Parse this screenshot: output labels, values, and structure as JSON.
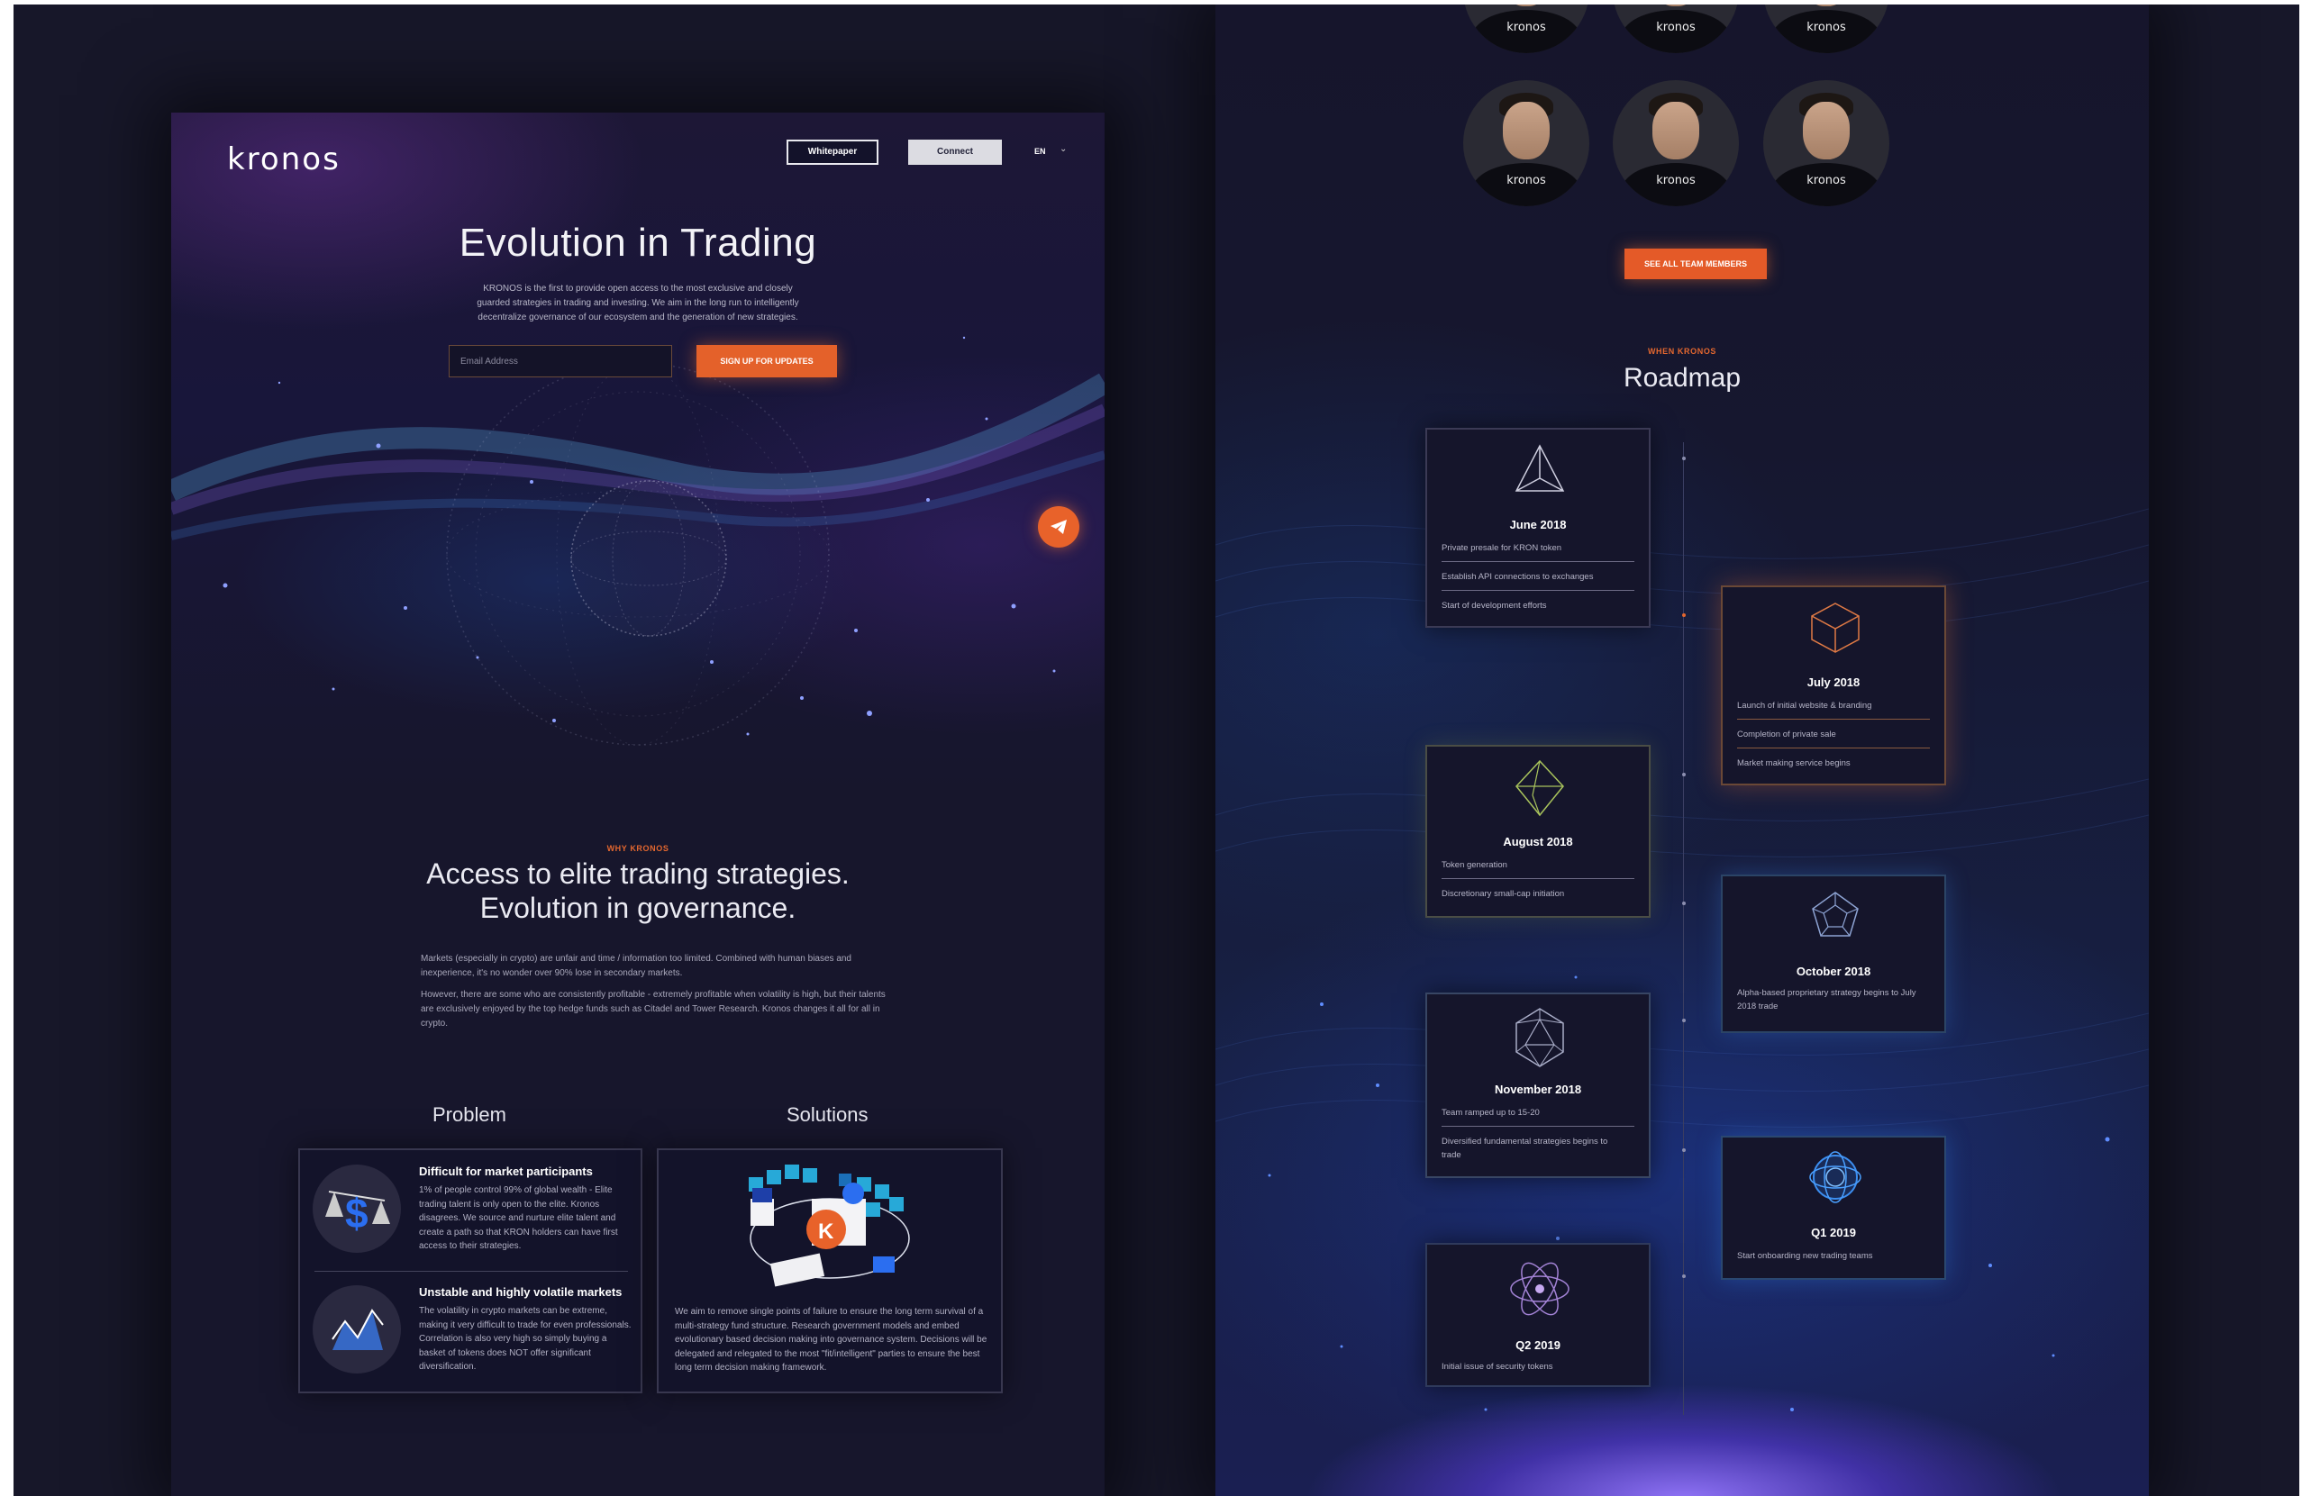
{
  "left_page": {
    "logo": "kronos",
    "nav": {
      "whitepaper_label": "Whitepaper",
      "connect_label": "Connect",
      "language": "EN"
    },
    "hero": {
      "title": "Evolution in Trading",
      "description": "KRONOS is the first to provide open access to the most exclusive and closely guarded strategies in trading and investing. We aim in the long run to intelligently decentralize governance of our ecosystem and the generation of new strategies.",
      "email_placeholder": "Email Address",
      "signup_label": "SIGN UP FOR UPDATES"
    },
    "why": {
      "kicker": "WHY KRONOS",
      "title_line1": "Access to elite trading strategies.",
      "title_line2": "Evolution in governance.",
      "para1": "Markets (especially in crypto) are unfair and time / information too limited. Combined with human biases and inexperience, it's no wonder over 90% lose in secondary markets.",
      "para2": "However, there are some who are consistently profitable - extremely profitable when volatility is high, but their talents are exclusively enjoyed by the top hedge funds such as Citadel and Tower Research. Kronos changes it all for all in crypto."
    },
    "problem": {
      "title": "Problem",
      "items": [
        {
          "heading": "Difficult for market participants",
          "text": "1% of people control 99% of global wealth - Elite trading talent is only open to the elite. Kronos disagrees. We source and nurture elite talent and create a path so that KRON holders can have first access to their strategies."
        },
        {
          "heading": "Unstable and highly volatile markets",
          "text": "The volatility in crypto markets can be extreme, making it very difficult to trade for even professionals. Correlation is also very high so simply buying a basket of tokens does NOT offer significant diversification."
        }
      ]
    },
    "solutions": {
      "title": "Solutions",
      "text": "We aim to remove single points of failure to ensure the long term survival of a multi-strategy fund structure. Research government models and embed evolutionary based decision making into governance system. Decisions will be delegated and relegated to the most \"fit/intelligent\" parties to ensure the best long term decision making framework."
    }
  },
  "right_page": {
    "team_brand": "kronos",
    "see_all_label": "SEE ALL TEAM MEMBERS",
    "roadmap_kicker": "WHEN KRONOS",
    "roadmap_title": "Roadmap",
    "milestones": [
      {
        "date": "June 2018",
        "items": [
          "Private presale for KRON token",
          "Establish API connections to exchanges",
          "Start of development efforts"
        ]
      },
      {
        "date": "July 2018",
        "items": [
          "Launch of initial website & branding",
          "Completion of private sale",
          "Market making service begins"
        ]
      },
      {
        "date": "August 2018",
        "items": [
          "Token generation",
          "Discretionary small-cap initiation"
        ]
      },
      {
        "date": "October 2018",
        "items": [
          "Alpha-based proprietary strategy begins to July 2018 trade"
        ]
      },
      {
        "date": "November 2018",
        "items": [
          "Team ramped up to 15-20",
          "Diversified fundamental strategies begins to trade"
        ]
      },
      {
        "date": "Q1 2019",
        "items": [
          "Start onboarding new trading teams"
        ]
      },
      {
        "date": "Q2 2019",
        "items": [
          "Initial issue of security tokens"
        ]
      }
    ]
  },
  "colors": {
    "accent_orange": "#e4612a",
    "background": "#17162c",
    "text_primary": "#ffffff",
    "text_secondary": "#b2b1c4"
  },
  "icons": [
    "telegram-icon",
    "scales-icon",
    "chart-icon",
    "tetrahedron-icon",
    "cube-icon",
    "octahedron-icon",
    "dodecahedron-icon",
    "icosahedron-icon",
    "atom-icon",
    "orbit-icon",
    "chevron-down-icon"
  ]
}
